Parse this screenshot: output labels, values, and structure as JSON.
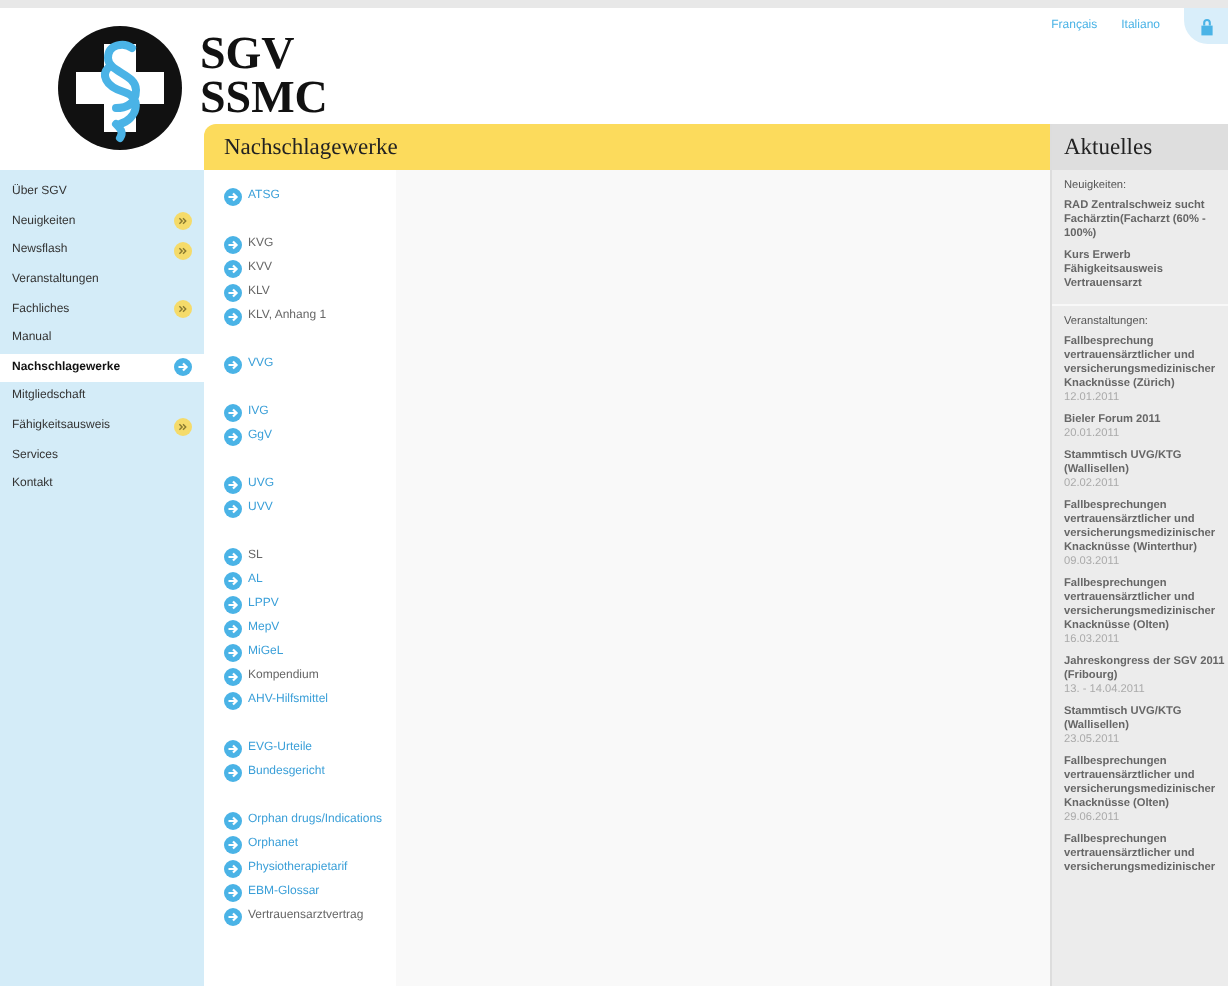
{
  "header": {
    "title_lines": [
      "SGV",
      "SSMC"
    ],
    "languages": [
      "Français",
      "Italiano"
    ]
  },
  "sidebar": {
    "items": [
      {
        "label": "Über SGV",
        "selected": false,
        "submenu": false
      },
      {
        "label": "Neuigkeiten",
        "selected": false,
        "submenu": true
      },
      {
        "label": "Newsflash",
        "selected": false,
        "submenu": true
      },
      {
        "label": "Veranstaltungen",
        "selected": false,
        "submenu": false
      },
      {
        "label": "Fachliches",
        "selected": false,
        "submenu": true
      },
      {
        "label": "Manual",
        "selected": false,
        "submenu": false
      },
      {
        "label": "Nachschlagewerke",
        "selected": true,
        "submenu": false
      },
      {
        "label": "Mitgliedschaft",
        "selected": false,
        "submenu": false
      },
      {
        "label": "Fähigkeitsausweis",
        "selected": false,
        "submenu": true
      },
      {
        "label": "Services",
        "selected": false,
        "submenu": false
      },
      {
        "label": "Kontakt",
        "selected": false,
        "submenu": false
      }
    ]
  },
  "main": {
    "title": "Nachschlagewerke",
    "groups": [
      [
        {
          "label": "ATSG",
          "kind": "link"
        }
      ],
      [
        {
          "label": "KVG",
          "kind": "plain"
        },
        {
          "label": "KVV",
          "kind": "plain"
        },
        {
          "label": "KLV",
          "kind": "plain"
        },
        {
          "label": "KLV, Anhang 1",
          "kind": "plain"
        }
      ],
      [
        {
          "label": "VVG",
          "kind": "link"
        }
      ],
      [
        {
          "label": "IVG",
          "kind": "link"
        },
        {
          "label": "GgV",
          "kind": "link"
        }
      ],
      [
        {
          "label": "UVG",
          "kind": "link"
        },
        {
          "label": "UVV",
          "kind": "link"
        }
      ],
      [
        {
          "label": "SL",
          "kind": "plain"
        },
        {
          "label": "AL",
          "kind": "link"
        },
        {
          "label": "LPPV",
          "kind": "link"
        },
        {
          "label": "MepV",
          "kind": "link"
        },
        {
          "label": "MiGeL",
          "kind": "link"
        },
        {
          "label": "Kompendium",
          "kind": "plain"
        },
        {
          "label": "AHV-Hilfsmittel",
          "kind": "link"
        }
      ],
      [
        {
          "label": "EVG-Urteile",
          "kind": "link"
        },
        {
          "label": "Bundesgericht",
          "kind": "link"
        }
      ],
      [
        {
          "label": "Orphan drugs/Indications",
          "kind": "link"
        },
        {
          "label": "Orphanet",
          "kind": "link"
        },
        {
          "label": "Physiotherapietarif",
          "kind": "link"
        },
        {
          "label": "EBM-Glossar",
          "kind": "link"
        },
        {
          "label": "Vertrauensarztvertrag",
          "kind": "plain"
        }
      ]
    ]
  },
  "aside": {
    "title": "Aktuelles",
    "sections": [
      {
        "heading": "Neuigkeiten:",
        "entries": [
          {
            "title": "RAD Zentralschweiz sucht Fachärztin(Facharzt (60% - 100%)"
          },
          {
            "title": "Kurs Erwerb Fähigkeitsausweis Vertrauensarzt"
          }
        ]
      },
      {
        "heading": "Veranstaltungen:",
        "entries": [
          {
            "title": "Fallbesprechung vertrauensärztlicher und versicherungsmedizinischer Knacknüsse (Zürich)",
            "date": "12.01.2011"
          },
          {
            "title": "Bieler Forum 2011",
            "date": "20.01.2011"
          },
          {
            "title": "Stammtisch UVG/KTG (Wallisellen)",
            "date": "02.02.2011"
          },
          {
            "title": "Fallbesprechungen vertrauensärztlicher und versicherungsmedizinischer Knacknüsse (Winterthur)",
            "date": "09.03.2011"
          },
          {
            "title": "Fallbesprechungen vertrauensärztlicher und versicherungsmedizinischer Knacknüsse (Olten)",
            "date": "16.03.2011"
          },
          {
            "title": "Jahreskongress der SGV 2011 (Fribourg)",
            "date": "13. - 14.04.2011"
          },
          {
            "title": "Stammtisch UVG/KTG (Wallisellen)",
            "date": "23.05.2011"
          },
          {
            "title": "Fallbesprechungen vertrauensärztlicher und versicherungsmedizinischer Knacknüsse (Olten)",
            "date": "29.06.2011"
          },
          {
            "title": "Fallbesprechungen vertrauensärztlicher und versicherungsmedizinischer"
          }
        ]
      }
    ]
  }
}
